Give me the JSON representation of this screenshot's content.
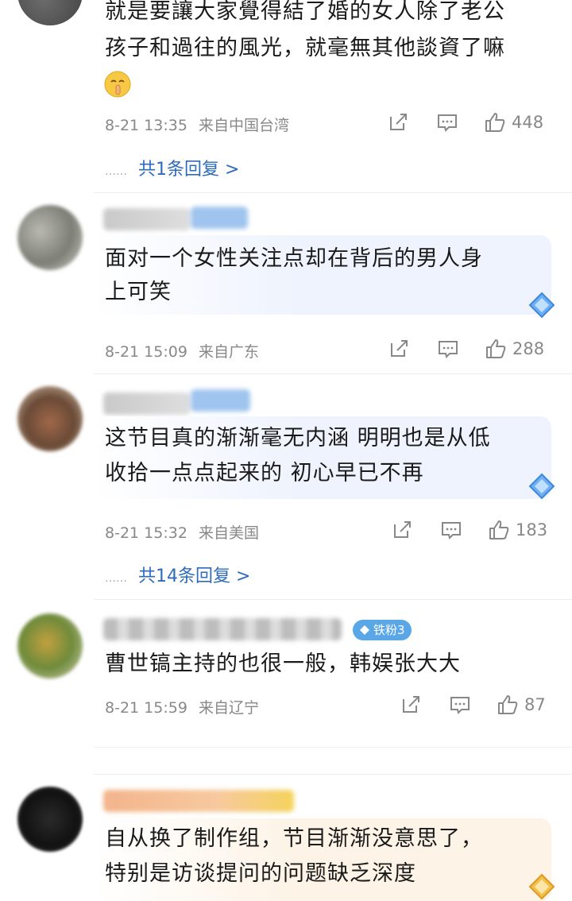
{
  "comments": [
    {
      "text_lines": [
        "就是要讓大家覺得結了婚的女人除了老公",
        "孩子和過往的風光，就毫無其他談資了嘛"
      ],
      "emoji": "shush-emoji",
      "time": "8-21 13:35",
      "location": "来自中国台湾",
      "likes": "448",
      "reply_prefix": "……",
      "reply_link": "共1条回复 >"
    },
    {
      "text_lines": [
        "面对一个女性关注点却在背后的男人身",
        "上可笑"
      ],
      "time": "8-21 15:09",
      "location": "来自广东",
      "likes": "288"
    },
    {
      "text_lines": [
        "这节目真的渐渐毫无内涵 明明也是从低",
        "收拾一点点起来的  初心早已不再"
      ],
      "time": "8-21 15:32",
      "location": "来自美国",
      "likes": "183",
      "reply_prefix": "……",
      "reply_link": "共14条回复 >"
    },
    {
      "text_lines": [
        "曹世镐主持的也很一般，韩娱张大大"
      ],
      "badge": "铁粉3",
      "time": "8-21 15:59",
      "location": "来自辽宁",
      "likes": "87"
    },
    {
      "text_lines": [
        "自从换了制作组，节目渐渐没意思了，",
        "特别是访谈提问的问题缺乏深度"
      ]
    }
  ],
  "colors": {
    "link": "#2e6bb8",
    "meta": "#888888",
    "bubble_blue": "#eef3fd",
    "bubble_orange": "#fdf3e6",
    "badge": "#5aa7e8"
  }
}
